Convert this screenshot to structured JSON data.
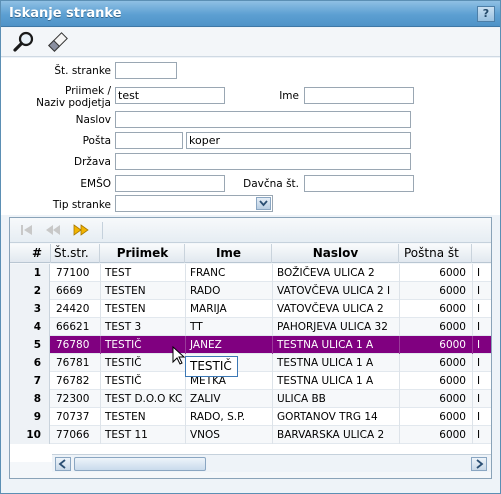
{
  "window": {
    "title": "Iskanje stranke",
    "help_label": "?"
  },
  "toolbar": {
    "search_icon": "magnifier-icon",
    "clear_icon": "eraser-icon"
  },
  "form": {
    "st_stranke": {
      "label": "Št. stranke",
      "value": ""
    },
    "priimek": {
      "label_line1": "Priimek /",
      "label_line2": "Naziv podjetja",
      "value": "test"
    },
    "ime": {
      "label": "Ime",
      "value": ""
    },
    "naslov": {
      "label": "Naslov",
      "value": ""
    },
    "posta": {
      "label": "Pošta",
      "code": "",
      "name": "koper"
    },
    "drzava": {
      "label": "Država",
      "value": ""
    },
    "emso": {
      "label": "EMŠO",
      "value": ""
    },
    "davcna": {
      "label": "Davčna št.",
      "value": ""
    },
    "tip": {
      "label": "Tip stranke",
      "value": ""
    }
  },
  "grid": {
    "columns": [
      "#",
      "Št.str.",
      "Priimek",
      "Ime",
      "Naslov",
      "Poštna št"
    ],
    "rows": [
      {
        "n": "1",
        "st": "77100",
        "priimek": "TEST",
        "ime": "FRANC",
        "naslov": "BOŽIČEVA ULICA 2",
        "posta": "6000",
        "extra": "I"
      },
      {
        "n": "2",
        "st": "6669",
        "priimek": "TESTEN",
        "ime": "RADO",
        "naslov": "VATOVČEVA ULICA 2 I",
        "posta": "6000",
        "extra": "I"
      },
      {
        "n": "3",
        "st": "24420",
        "priimek": "TESTEN",
        "ime": "MARIJA",
        "naslov": "VATOVČEVA ULICA 2",
        "posta": "6000",
        "extra": "I"
      },
      {
        "n": "4",
        "st": "66621",
        "priimek": "TEST 3",
        "ime": "TT",
        "naslov": "PAHORJEVA ULICA 32",
        "posta": "6000",
        "extra": "I"
      },
      {
        "n": "5",
        "st": "76780",
        "priimek": "TESTIČ",
        "ime": "JANEZ",
        "naslov": "TESTNA ULICA 1 A",
        "posta": "6000",
        "extra": "I"
      },
      {
        "n": "6",
        "st": "76781",
        "priimek": "TESTIČ",
        "ime": "",
        "naslov": "TESTNA ULICA 1 A",
        "posta": "6000",
        "extra": "I"
      },
      {
        "n": "7",
        "st": "76782",
        "priimek": "TESTIČ",
        "ime": "METKA",
        "naslov": "TESTNA ULICA 1 A",
        "posta": "6000",
        "extra": "I"
      },
      {
        "n": "8",
        "st": "72300",
        "priimek": "TEST D.O.O KC",
        "ime": "ZALIV",
        "naslov": "ULICA BB",
        "posta": "6000",
        "extra": "I"
      },
      {
        "n": "9",
        "st": "70737",
        "priimek": "TESTEN",
        "ime": "RADO, S.P.",
        "naslov": "GORTANOV TRG 14",
        "posta": "6000",
        "extra": "I"
      },
      {
        "n": "10",
        "st": "77066",
        "priimek": "TEST 11",
        "ime": "VNOS",
        "naslov": "BARVARSKA ULICA 2",
        "posta": "6000",
        "extra": "I"
      }
    ],
    "selected_row": 5
  },
  "tooltip": {
    "text": "TESTIČ"
  },
  "colors": {
    "selection": "#800080",
    "titlebar": "#5c9fd2"
  }
}
